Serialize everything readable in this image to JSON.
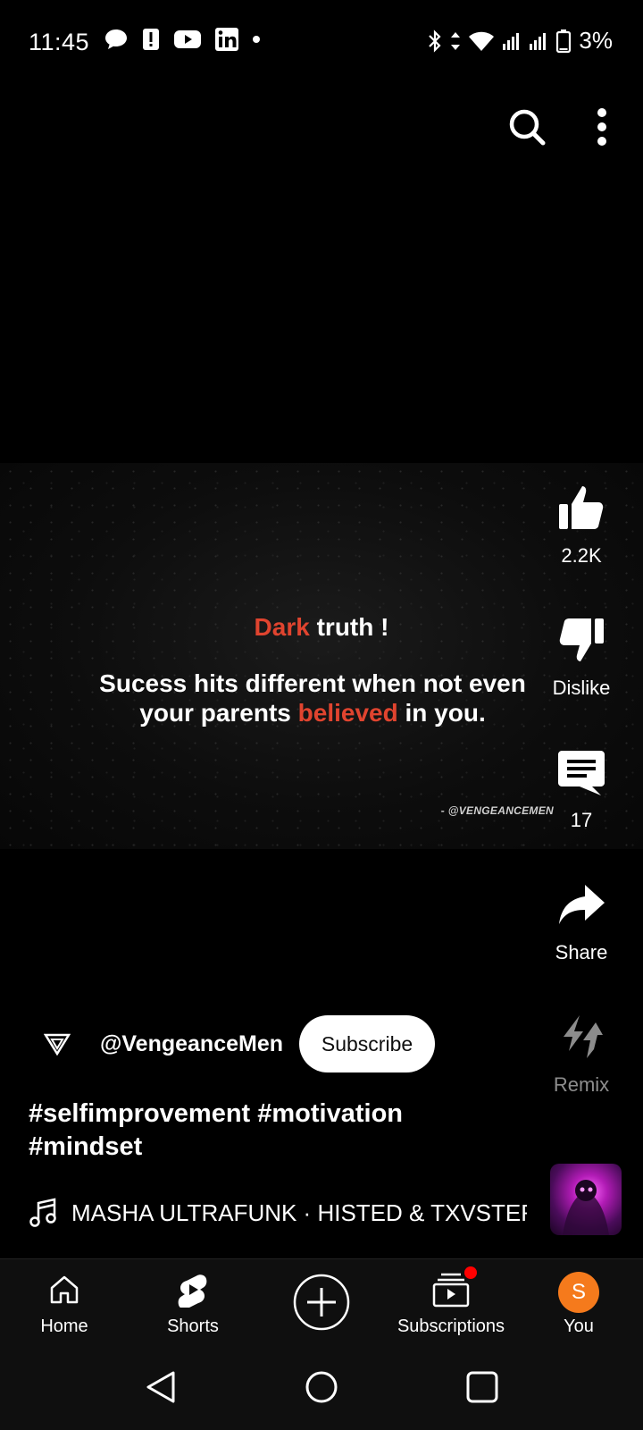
{
  "status_bar": {
    "time": "11:45",
    "left_icons": [
      "chat-bubble-icon",
      "alert-icon",
      "youtube-icon",
      "linkedin-icon",
      "dot-icon"
    ],
    "right_icons": [
      "bluetooth-icon",
      "data-arrows-icon",
      "wifi-icon",
      "signal-icon",
      "signal-icon",
      "battery-icon"
    ],
    "battery": "3%"
  },
  "top_actions": [
    "search-icon",
    "more-vertical-icon"
  ],
  "video": {
    "line1_red": "Dark",
    "line1_rest": " truth !",
    "line2_a": "Sucess hits different when not even",
    "line2_b": "your parents ",
    "line2_red": "believed",
    "line2_c": " in you.",
    "signature": "- @VENGEANCEMEN"
  },
  "actions": {
    "like_count": "2.2K",
    "dislike_label": "Dislike",
    "comment_count": "17",
    "share_label": "Share",
    "remix_label": "Remix"
  },
  "channel": {
    "handle": "@VengeanceMen",
    "subscribe_label": "Subscribe"
  },
  "caption": {
    "line1": "#selfimprovement #motivation",
    "line2": "#mindset"
  },
  "music": {
    "track": "MASHA ULTRAFUNK · HISTED & TXVSTERPLAYA"
  },
  "nav": {
    "home": "Home",
    "shorts": "Shorts",
    "subscriptions": "Subscriptions",
    "you": "You",
    "avatar_letter": "S"
  },
  "colors": {
    "accent_red": "#e0442f",
    "avatar": "#f57a1c",
    "notification_dot": "#ff0000"
  }
}
